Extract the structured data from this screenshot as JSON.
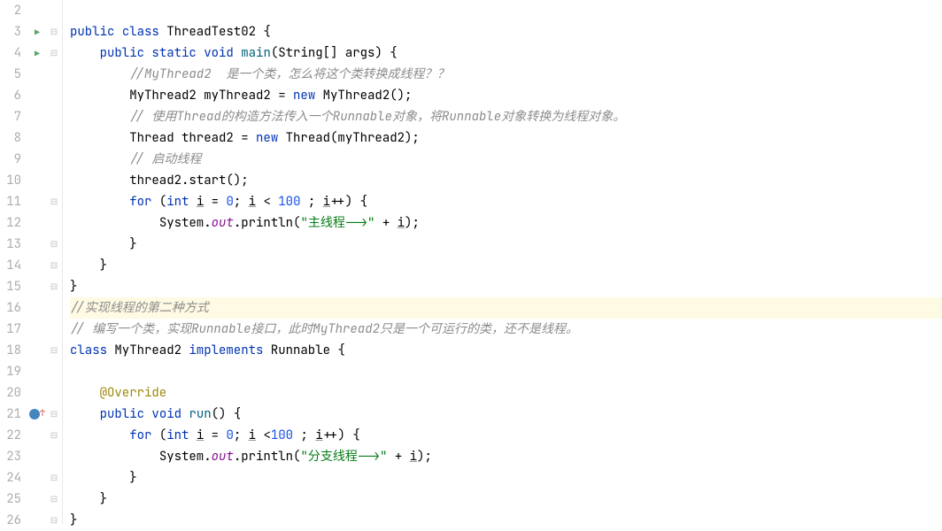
{
  "lines": [
    {
      "num": "2",
      "icon": "",
      "fold": "",
      "indent": "",
      "tokens": []
    },
    {
      "num": "3",
      "icon": "run",
      "fold": "⊟",
      "indent": "",
      "tokens": [
        {
          "t": "public",
          "c": "kw"
        },
        {
          "t": " "
        },
        {
          "t": "class",
          "c": "kw"
        },
        {
          "t": " ThreadTest02 {"
        }
      ]
    },
    {
      "num": "4",
      "icon": "run",
      "fold": "⊟",
      "indent": "    ",
      "tokens": [
        {
          "t": "public",
          "c": "kw"
        },
        {
          "t": " "
        },
        {
          "t": "static",
          "c": "kw"
        },
        {
          "t": " "
        },
        {
          "t": "void",
          "c": "kw"
        },
        {
          "t": " "
        },
        {
          "t": "main",
          "c": "method-decl"
        },
        {
          "t": "(String[] args) {"
        }
      ]
    },
    {
      "num": "5",
      "icon": "",
      "fold": "",
      "indent": "        ",
      "tokens": [
        {
          "t": "//MyThread2  是一个类，怎么将这个类转换成线程？？",
          "c": "comment"
        }
      ]
    },
    {
      "num": "6",
      "icon": "",
      "fold": "",
      "indent": "        ",
      "tokens": [
        {
          "t": "MyThread2 myThread2 = "
        },
        {
          "t": "new",
          "c": "kw"
        },
        {
          "t": " MyThread2();"
        }
      ]
    },
    {
      "num": "7",
      "icon": "",
      "fold": "",
      "indent": "        ",
      "tokens": [
        {
          "t": "// 使用Thread的构造方法传入一个Runnable对象，将Runnable对象转换为线程对象。",
          "c": "comment"
        }
      ]
    },
    {
      "num": "8",
      "icon": "",
      "fold": "",
      "indent": "        ",
      "tokens": [
        {
          "t": "Thread thread2 = "
        },
        {
          "t": "new",
          "c": "kw"
        },
        {
          "t": " Thread(myThread2);"
        }
      ]
    },
    {
      "num": "9",
      "icon": "",
      "fold": "",
      "indent": "        ",
      "tokens": [
        {
          "t": "// 启动线程",
          "c": "comment"
        }
      ]
    },
    {
      "num": "10",
      "icon": "",
      "fold": "",
      "indent": "        ",
      "tokens": [
        {
          "t": "thread2.start();"
        }
      ]
    },
    {
      "num": "11",
      "icon": "",
      "fold": "⊟",
      "indent": "        ",
      "tokens": [
        {
          "t": "for",
          "c": "kw"
        },
        {
          "t": " ("
        },
        {
          "t": "int",
          "c": "kw"
        },
        {
          "t": " "
        },
        {
          "t": "i",
          "c": "underline"
        },
        {
          "t": " = "
        },
        {
          "t": "0",
          "c": "num"
        },
        {
          "t": "; "
        },
        {
          "t": "i",
          "c": "underline"
        },
        {
          "t": " < "
        },
        {
          "t": "100",
          "c": "num"
        },
        {
          "t": " ; "
        },
        {
          "t": "i",
          "c": "underline"
        },
        {
          "t": "++) {"
        }
      ]
    },
    {
      "num": "12",
      "icon": "",
      "fold": "",
      "indent": "            ",
      "tokens": [
        {
          "t": "System."
        },
        {
          "t": "out",
          "c": "static-field"
        },
        {
          "t": ".println("
        },
        {
          "t": "\"主线程-->\"",
          "c": "str"
        },
        {
          "t": " + "
        },
        {
          "t": "i",
          "c": "underline"
        },
        {
          "t": ");"
        }
      ]
    },
    {
      "num": "13",
      "icon": "",
      "fold": "⊟",
      "indent": "        ",
      "tokens": [
        {
          "t": "}"
        }
      ]
    },
    {
      "num": "14",
      "icon": "",
      "fold": "⊟",
      "indent": "    ",
      "tokens": [
        {
          "t": "}"
        }
      ]
    },
    {
      "num": "15",
      "icon": "",
      "fold": "⊟",
      "indent": "",
      "tokens": [
        {
          "t": "}"
        }
      ]
    },
    {
      "num": "16",
      "icon": "",
      "fold": "",
      "indent": "",
      "highlight": true,
      "tokens": [
        {
          "t": "//实现线程的第二种方式",
          "c": "comment"
        }
      ]
    },
    {
      "num": "17",
      "icon": "",
      "fold": "",
      "indent": "",
      "tokens": [
        {
          "t": "// 编写一个类，实现Runnable接口，此时MyThread2只是一个可运行的类，还不是线程。",
          "c": "comment"
        }
      ]
    },
    {
      "num": "18",
      "icon": "",
      "fold": "⊟",
      "indent": "",
      "tokens": [
        {
          "t": "class",
          "c": "kw"
        },
        {
          "t": " MyThread2 "
        },
        {
          "t": "implements",
          "c": "kw"
        },
        {
          "t": " Runnable {"
        }
      ]
    },
    {
      "num": "19",
      "icon": "",
      "fold": "",
      "indent": "",
      "tokens": []
    },
    {
      "num": "20",
      "icon": "",
      "fold": "",
      "indent": "    ",
      "tokens": [
        {
          "t": "@Override",
          "c": "annotation"
        }
      ]
    },
    {
      "num": "21",
      "icon": "override",
      "fold": "⊟",
      "indent": "    ",
      "tokens": [
        {
          "t": "public",
          "c": "kw"
        },
        {
          "t": " "
        },
        {
          "t": "void",
          "c": "kw"
        },
        {
          "t": " "
        },
        {
          "t": "run",
          "c": "method-decl"
        },
        {
          "t": "() {"
        }
      ]
    },
    {
      "num": "22",
      "icon": "",
      "fold": "⊟",
      "indent": "        ",
      "tokens": [
        {
          "t": "for",
          "c": "kw"
        },
        {
          "t": " ("
        },
        {
          "t": "int",
          "c": "kw"
        },
        {
          "t": " "
        },
        {
          "t": "i",
          "c": "underline"
        },
        {
          "t": " = "
        },
        {
          "t": "0",
          "c": "num"
        },
        {
          "t": "; "
        },
        {
          "t": "i",
          "c": "underline"
        },
        {
          "t": " <"
        },
        {
          "t": "100",
          "c": "num"
        },
        {
          "t": " ; "
        },
        {
          "t": "i",
          "c": "underline"
        },
        {
          "t": "++) {"
        }
      ]
    },
    {
      "num": "23",
      "icon": "",
      "fold": "",
      "indent": "            ",
      "tokens": [
        {
          "t": "System."
        },
        {
          "t": "out",
          "c": "static-field"
        },
        {
          "t": ".println("
        },
        {
          "t": "\"分支线程-->\"",
          "c": "str"
        },
        {
          "t": " + "
        },
        {
          "t": "i",
          "c": "underline"
        },
        {
          "t": ");"
        }
      ]
    },
    {
      "num": "24",
      "icon": "",
      "fold": "⊟",
      "indent": "        ",
      "tokens": [
        {
          "t": "}"
        }
      ]
    },
    {
      "num": "25",
      "icon": "",
      "fold": "⊟",
      "indent": "    ",
      "tokens": [
        {
          "t": "}"
        }
      ]
    },
    {
      "num": "26",
      "icon": "",
      "fold": "⊟",
      "indent": "",
      "tokens": [
        {
          "t": "}"
        }
      ]
    }
  ]
}
